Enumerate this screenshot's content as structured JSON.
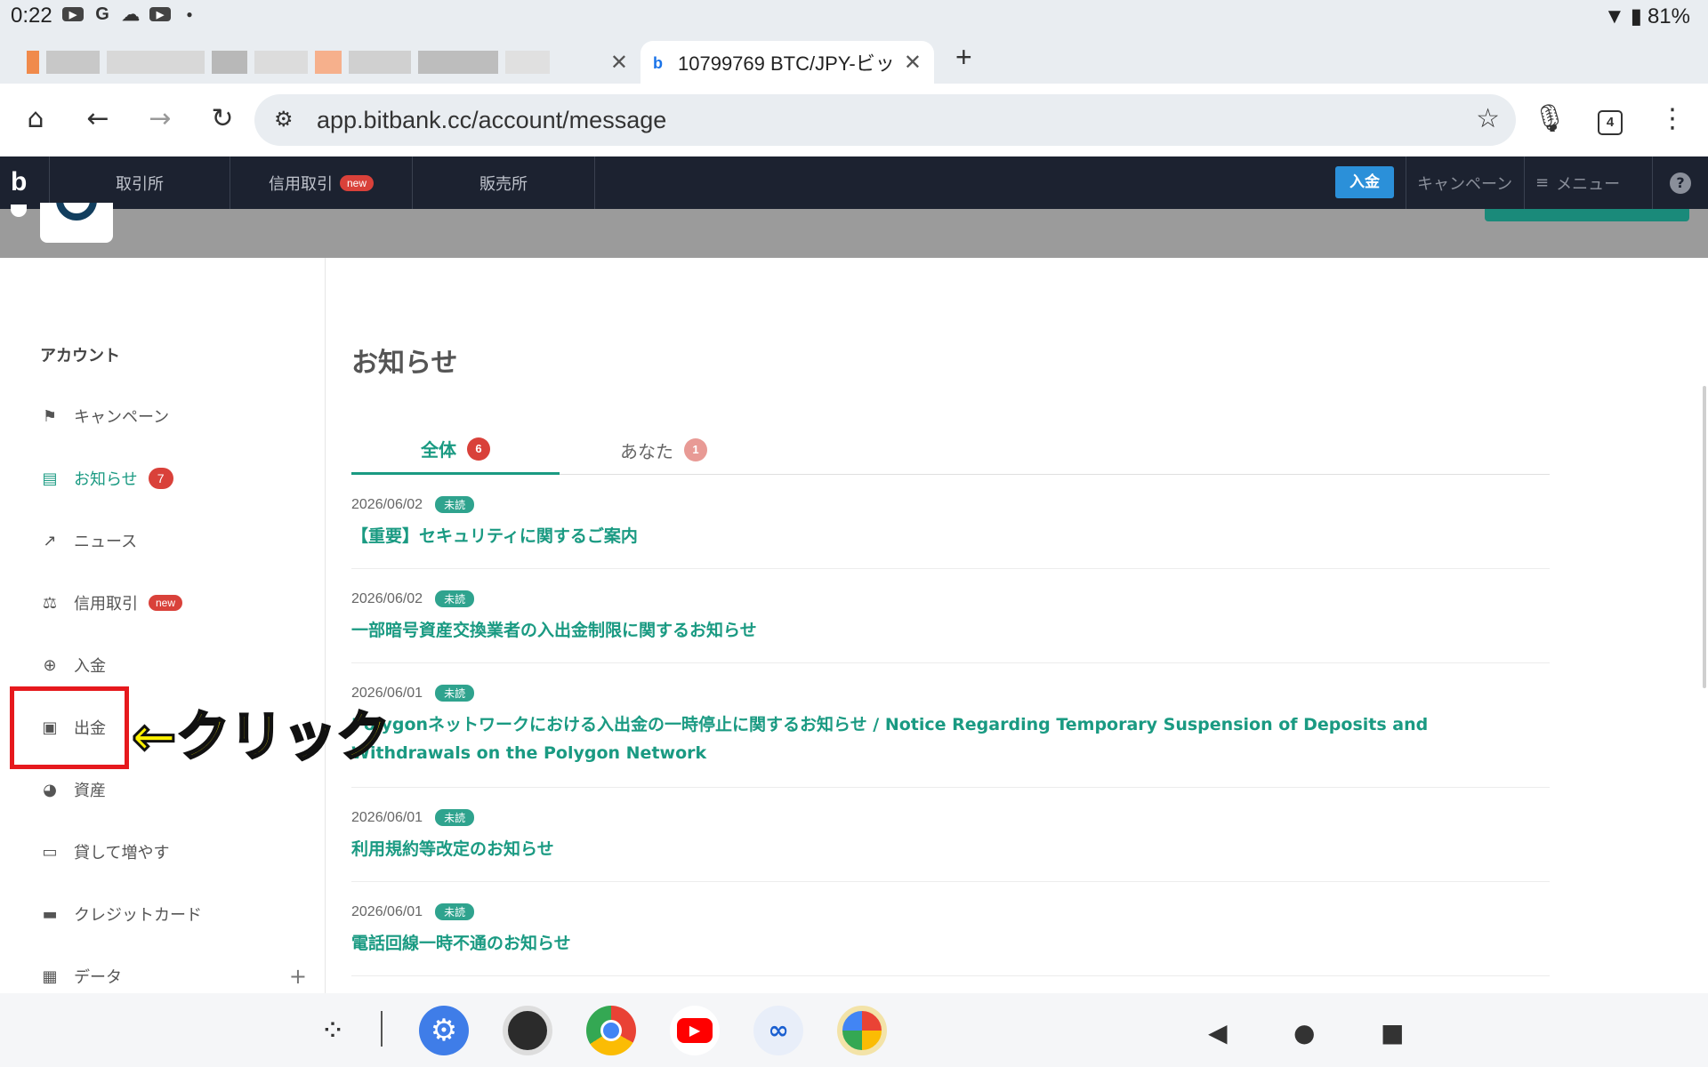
{
  "status_bar": {
    "time": "0:22",
    "battery": "81%",
    "icons": [
      "youtube-icon",
      "google-icon",
      "cloud-icon",
      "youtube-icon",
      "dot-icon"
    ]
  },
  "browser": {
    "tabs": [
      {
        "title": "",
        "blurred": true
      },
      {
        "title": "10799769 BTC/JPY-ビッ",
        "active": true
      }
    ],
    "new_tab_label": "+",
    "url": "app.bitbank.cc/account/message",
    "tab_count": "4"
  },
  "site_nav": {
    "items": [
      {
        "label": "取引所"
      },
      {
        "label": "信用取引",
        "badge": "new"
      },
      {
        "label": "販売所"
      }
    ],
    "deposit_label": "入金",
    "campaign_label": "キャンペーン",
    "menu_label": "メニュー",
    "help_label": "?"
  },
  "sidebar": {
    "title": "アカウント",
    "items": [
      {
        "label": "キャンペーン",
        "icon": "flag-icon"
      },
      {
        "label": "お知らせ",
        "icon": "message-icon",
        "count": "7",
        "active": true
      },
      {
        "label": "ニュース",
        "icon": "news-icon"
      },
      {
        "label": "信用取引",
        "icon": "scale-icon",
        "badge": "new"
      },
      {
        "label": "入金",
        "icon": "plus-circle-icon"
      },
      {
        "label": "出金",
        "icon": "wallet-icon"
      },
      {
        "label": "資産",
        "icon": "pie-icon"
      },
      {
        "label": "貸して増やす",
        "icon": "cash-icon"
      },
      {
        "label": "クレジットカード",
        "icon": "card-icon"
      },
      {
        "label": "データ",
        "icon": "clipboard-icon",
        "expand": "+"
      }
    ]
  },
  "annotation": {
    "text": "←クリック",
    "color": "#fff200",
    "box_color": "#e6191d"
  },
  "main": {
    "title": "お知らせ",
    "tabs": [
      {
        "label": "全体",
        "count": "6"
      },
      {
        "label": "あなた",
        "count": "1"
      }
    ],
    "unread_label": "未読",
    "messages": [
      {
        "date": "2026/06/02",
        "title": "【重要】セキュリティに関するご案内"
      },
      {
        "date": "2026/06/02",
        "title": "一部暗号資産交換業者の入出金制限に関するお知らせ"
      },
      {
        "date": "2026/06/01",
        "title": "Polygonネットワークにおける入出金の一時停止に関するお知らせ / Notice Regarding Temporary Suspension of Deposits and Withdrawals on the Polygon Network"
      },
      {
        "date": "2026/06/01",
        "title": "利用規約等改定のお知らせ"
      },
      {
        "date": "2026/06/01",
        "title": "電話回線一時不通のお知らせ"
      }
    ]
  },
  "colors": {
    "accent": "#1a9a82",
    "header_bg": "#1c2230",
    "badge_red": "#d9413a",
    "deposit_blue": "#2b90d9"
  },
  "dock": [
    "apps-search-icon",
    "settings-icon",
    "camera-icon",
    "chrome-icon",
    "youtube-icon",
    "meta-icon",
    "photos-icon"
  ]
}
